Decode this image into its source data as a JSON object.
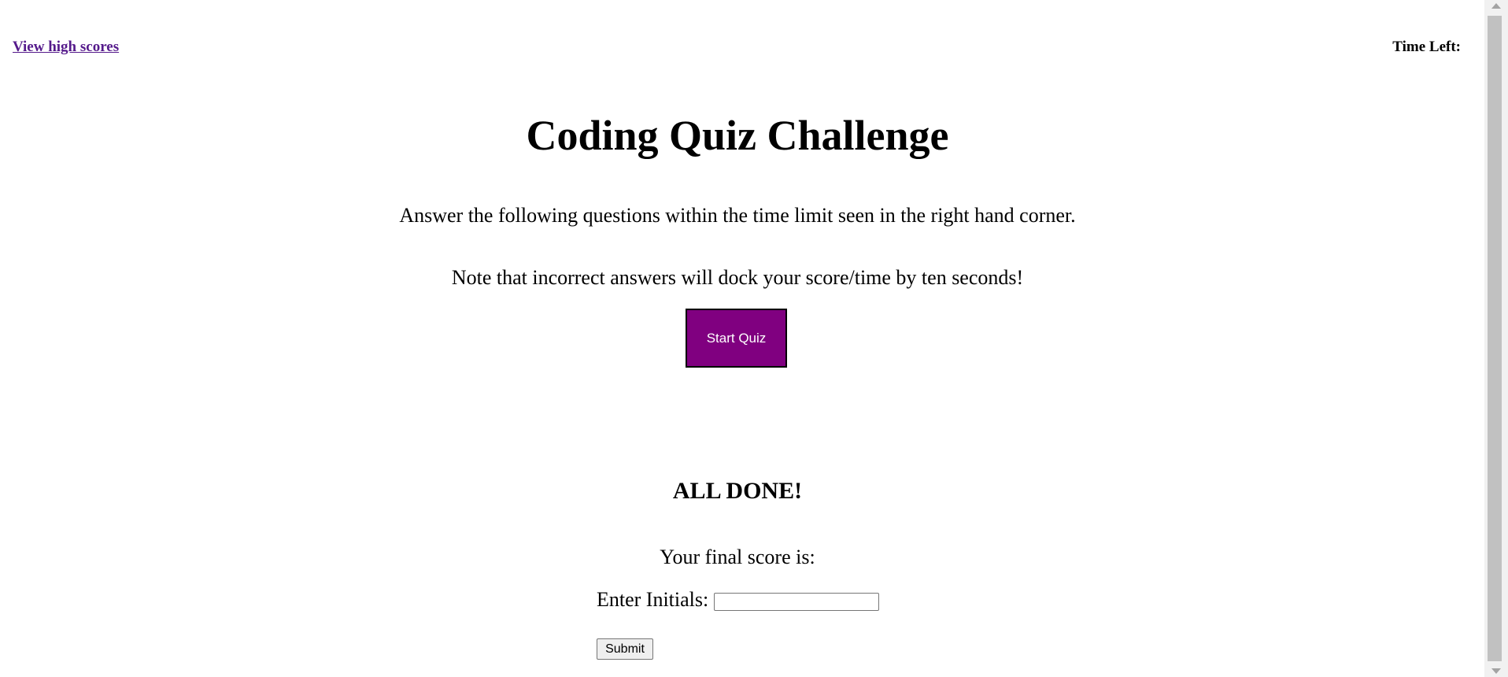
{
  "header": {
    "high_scores_link": "View high scores",
    "timer_label": "Time Left:"
  },
  "intro": {
    "title": "Coding Quiz Challenge",
    "instructions": "Answer the following questions within the time limit seen in the right hand corner.",
    "note": "Note that incorrect answers will dock your score/time by ten seconds!",
    "start_button": "Start Quiz"
  },
  "results": {
    "heading": "ALL DONE!",
    "final_score_label": "Your final score is:",
    "initials_label": "Enter Initials:",
    "initials_value": "",
    "submit_button": "Submit"
  },
  "colors": {
    "start_button_bg": "#800080",
    "link_color": "#551a8b"
  }
}
